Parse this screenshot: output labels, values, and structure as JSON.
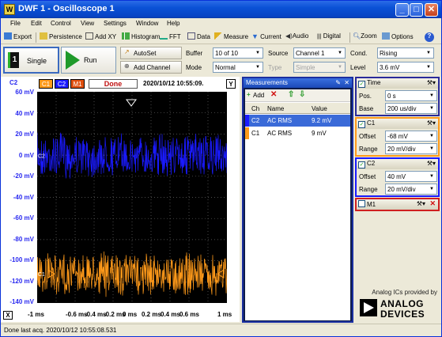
{
  "window": {
    "title": "DWF 1 - Oscilloscope 1",
    "app_icon_letter": "W"
  },
  "menu": [
    "File",
    "Edit",
    "Control",
    "View",
    "Settings",
    "Window",
    "Help"
  ],
  "toolbar": {
    "export": "Export",
    "persistence": "Persistence",
    "addxy": "Add XY",
    "histogram": "Histogram",
    "fft": "FFT",
    "data": "Data",
    "measure": "Measure",
    "current": "Current",
    "audio": "Audio",
    "digital": "Digital",
    "zoom": "Zoom",
    "options": "Options"
  },
  "controls": {
    "single": "Single",
    "single_icon_text": "1",
    "run": "Run",
    "autoset": "AutoSet",
    "add_channel": "Add Channel",
    "buffer_label": "Buffer",
    "buffer_value": "10 of 10",
    "mode_label": "Mode",
    "mode_value": "Normal",
    "source_label": "Source",
    "source_value": "Channel 1",
    "type_label": "Type",
    "type_value": "Simple",
    "cond_label": "Cond.",
    "cond_value": "Rising",
    "level_label": "Level",
    "level_value": "3.6 mV"
  },
  "plot": {
    "channel_label": "C2",
    "badge_c1": "C1",
    "badge_c2": "C2",
    "badge_m1": "M1",
    "state": "Done",
    "timestamp": "2020/10/12  10:55:09.",
    "y_button": "Y",
    "x_button": "X",
    "trace_label_c2": "C2",
    "trace_label_c1": "C1",
    "y_labels": [
      "60 mV",
      "40 mV",
      "20 mV",
      "0 mV",
      "-20 mV",
      "-40 mV",
      "-60 mV",
      "-80 mV",
      "-100 mV",
      "-120 mV",
      "-140 mV"
    ],
    "x_labels": [
      "-1 ms",
      "-0.6 ms",
      "-0.4 ms",
      "-0.2 ms",
      "0 ms",
      "0.2 ms",
      "0.4 ms",
      "0.6 ms",
      "1 ms"
    ],
    "colors": {
      "c1": "#ff9a1a",
      "c2": "#1a1aff",
      "background": "#000000",
      "grid": "#666666"
    }
  },
  "measurements": {
    "title": "Measurements",
    "add": "Add",
    "columns": [
      "Ch",
      "Name",
      "Value"
    ],
    "rows": [
      {
        "ch": "C2",
        "name": "AC RMS",
        "value": "9.2 mV"
      },
      {
        "ch": "C1",
        "name": "AC RMS",
        "value": "9 mV"
      }
    ]
  },
  "time_panel": {
    "title": "Time",
    "pos_label": "Pos.",
    "pos_value": "0 s",
    "base_label": "Base",
    "base_value": "200 us/div"
  },
  "c1_panel": {
    "title": "C1",
    "offset_label": "Offset",
    "offset_value": "-68 mV",
    "range_label": "Range",
    "range_value": "20 mV/div"
  },
  "c2_panel": {
    "title": "C2",
    "offset_label": "Offset",
    "offset_value": "40 mV",
    "range_label": "Range",
    "range_value": "20 mV/div"
  },
  "m1_panel": {
    "title": "M1"
  },
  "branding": {
    "line1": "Analog ICs provided by",
    "line2": "ANALOG",
    "line3": "DEVICES"
  },
  "status": "Done last acq. 2020/10/12  10:55:08.531"
}
